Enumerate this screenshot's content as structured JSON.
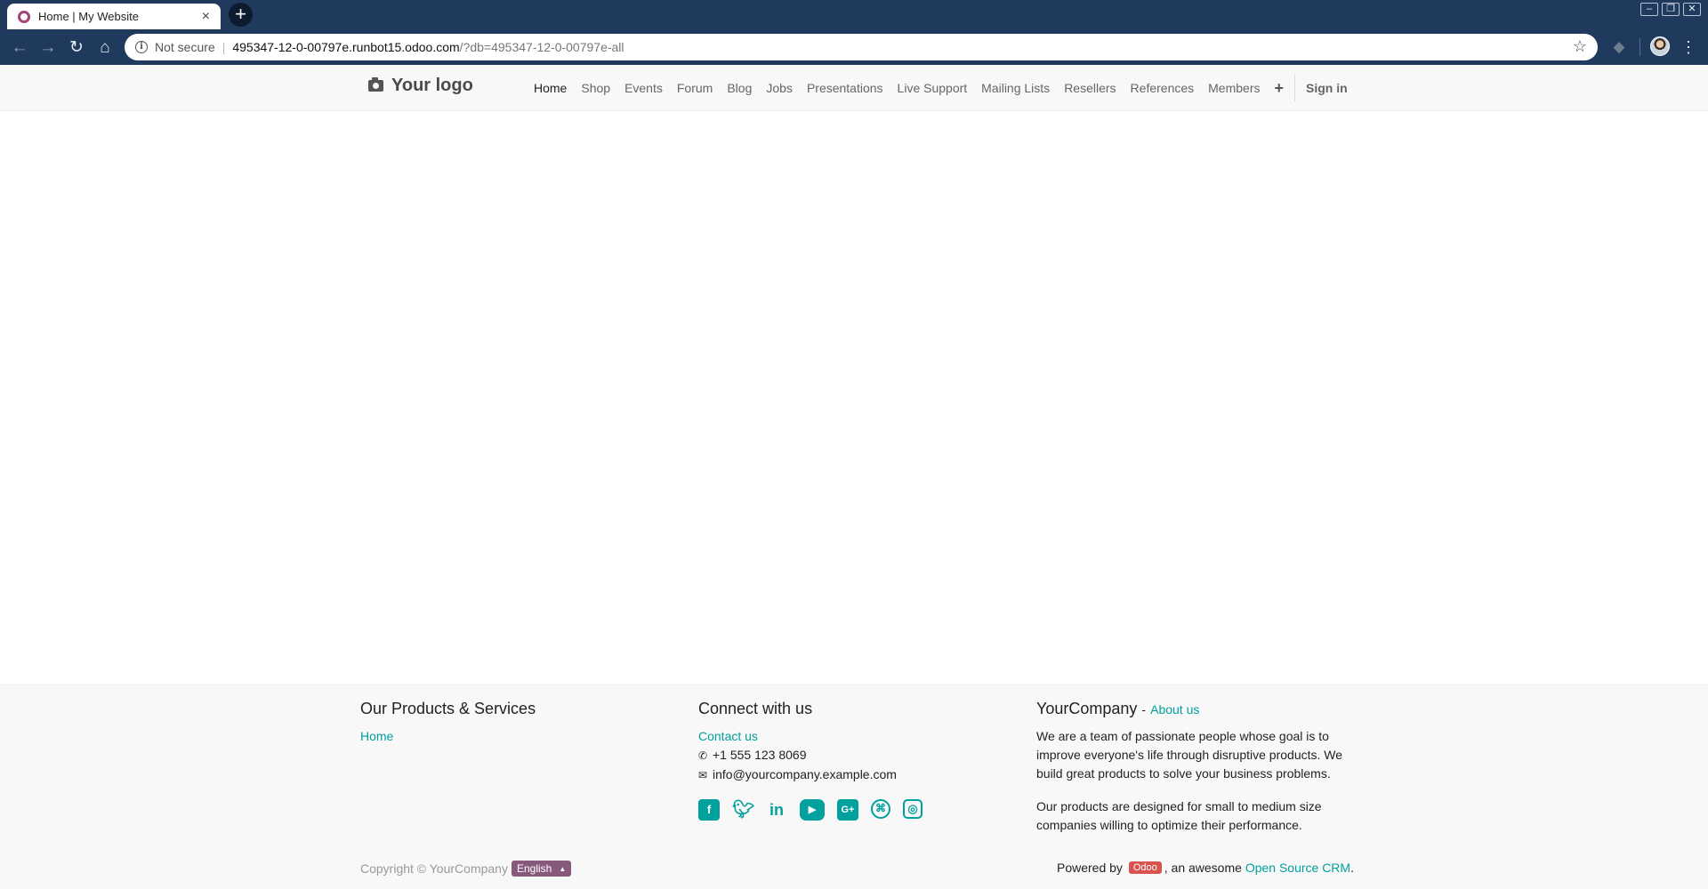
{
  "browser": {
    "tab": {
      "title": "Home | My Website",
      "close": "×"
    },
    "new_tab": "+",
    "window_buttons": {
      "minimize": "–",
      "restore": "❐",
      "close": "✕"
    },
    "nav": {
      "back": "←",
      "forward": "→",
      "reload": "↻",
      "home": "⌂"
    },
    "address": {
      "security_icon": "i",
      "security_label": "Not secure",
      "host": "495347-12-0-00797e.runbot15.odoo.com",
      "path": "/?db=495347-12-0-00797e-all"
    },
    "star_icon": "☆",
    "ext_icon": "◆",
    "menu_icon": "⋮"
  },
  "site": {
    "logo": "Your logo",
    "nav_items": [
      "Home",
      "Shop",
      "Events",
      "Forum",
      "Blog",
      "Jobs",
      "Presentations",
      "Live Support",
      "Mailing Lists",
      "Resellers",
      "References",
      "Members"
    ],
    "nav_plus": "+",
    "sign_in": "Sign in"
  },
  "footer": {
    "products": {
      "heading": "Our Products & Services",
      "link": "Home"
    },
    "connect": {
      "heading": "Connect with us",
      "contact": "Contact us",
      "phone": "+1 555 123 8069",
      "email": "info@yourcompany.example.com",
      "socials": [
        "facebook-icon",
        "twitter-icon",
        "linkedin-icon",
        "youtube-icon",
        "google-plus-icon",
        "github-icon",
        "instagram-icon"
      ]
    },
    "company": {
      "name": "YourCompany",
      "separator": "-",
      "about": "About us",
      "para1": "We are a team of passionate people whose goal is to improve everyone's life through disruptive products. We build great products to solve your business problems.",
      "para2": "Our products are designed for small to medium size companies willing to optimize their performance."
    },
    "copyright": "Copyright © YourCompany",
    "language": "English",
    "powered_prefix": "Powered by",
    "odoo_badge": "Odoo",
    "powered_middle": ", an awesome",
    "crm_link": "Open Source CRM",
    "powered_suffix": "."
  },
  "colors": {
    "chrome": "#1f3a5c",
    "link": "#00a09d",
    "lang_button": "#875a7b",
    "odoo_badge": "#d9534f"
  }
}
